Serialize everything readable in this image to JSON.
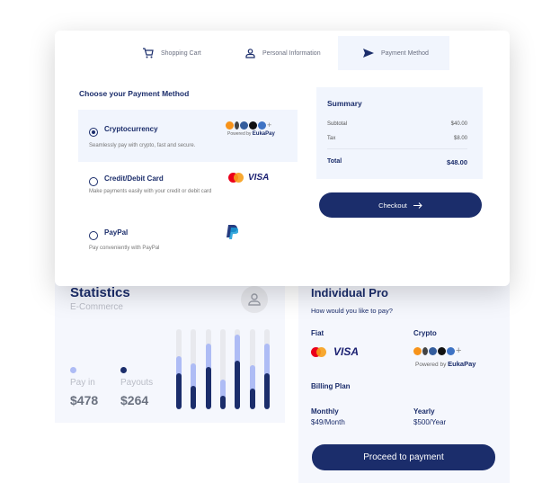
{
  "steps": [
    {
      "label": "Shopping Cart",
      "icon": "cart-icon"
    },
    {
      "label": "Personal Information",
      "icon": "user-icon"
    },
    {
      "label": "Payment Method",
      "icon": "send-icon",
      "active": true
    }
  ],
  "payment": {
    "title": "Choose your Payment Method",
    "options": [
      {
        "label": "Cryptocurrency",
        "desc": "Seamlessly pay with crypto, fast and secure.",
        "selected": true,
        "powered": "Powered by",
        "brand": "EukaPay"
      },
      {
        "label": "Credit/Debit Card",
        "desc": "Make payments easily with your credit or debit card",
        "selected": false,
        "visa": "VISA"
      },
      {
        "label": "PayPal",
        "desc": "Pay conveniently with PayPal",
        "selected": false
      }
    ]
  },
  "summary": {
    "title": "Summary",
    "subtotal_label": "Subtotal",
    "subtotal": "$40.00",
    "tax_label": "Tax",
    "tax": "$8.00",
    "total_label": "Total",
    "total": "$48.00"
  },
  "checkout_label": "Checkout",
  "stats": {
    "title": "Statistics",
    "subtitle": "E-Commerce",
    "pay_in_label": "Pay in",
    "pay_in": "$478",
    "payouts_label": "Payouts",
    "payouts": "$264",
    "bars": {
      "pay_in": [
        0.66,
        0.57,
        0.82,
        0.37,
        0.93,
        0.55,
        0.82
      ],
      "payouts": [
        0.45,
        0.29,
        0.53,
        0.17,
        0.61,
        0.26,
        0.45
      ]
    },
    "colors": {
      "pay_in": "#aebcf5",
      "payouts": "#1b2d6b",
      "track": "#e8e9ee"
    }
  },
  "pro": {
    "title": "Individual Pro",
    "question": "How would you like to pay?",
    "fiat": "Fiat",
    "crypto": "Crypto",
    "visa": "VISA",
    "powered": "Powered by",
    "brand": "EukaPay",
    "billing": "Billing Plan",
    "monthly": "Monthly",
    "monthly_price": "$49/Month",
    "yearly": "Yearly",
    "yearly_price": "$500/Year",
    "cta": "Proceed to payment"
  },
  "colors": {
    "accent": "#1b2d6b",
    "panel": "#f1f5fd"
  }
}
